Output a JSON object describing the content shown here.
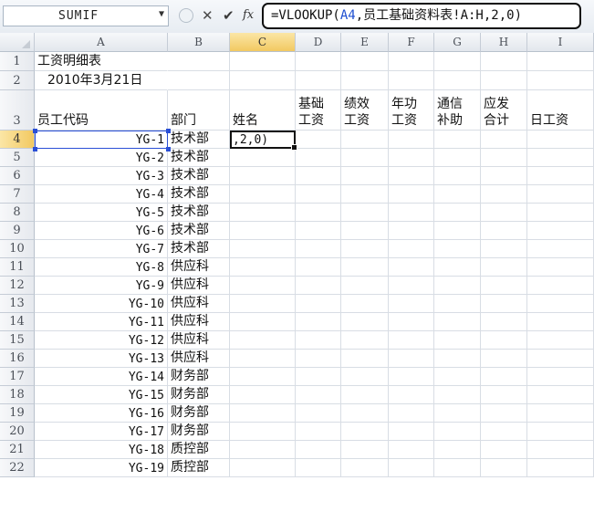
{
  "formula_bar": {
    "name_box": "SUMIF",
    "cancel_icon": "✕",
    "enter_icon": "✔",
    "fx_label": "fx",
    "formula_prefix": "=VLOOKUP(",
    "formula_ref": "A4",
    "formula_suffix": ",员工基础资料表!A:H,2,0)"
  },
  "columns": [
    "A",
    "B",
    "C",
    "D",
    "E",
    "F",
    "G",
    "H",
    "I"
  ],
  "active_column": "C",
  "active_row": "4",
  "rows": [
    "1",
    "2",
    "3",
    "4",
    "5",
    "6",
    "7",
    "8",
    "9",
    "10",
    "11",
    "12",
    "13",
    "14",
    "15",
    "16",
    "17",
    "18",
    "19",
    "20",
    "21",
    "22"
  ],
  "title": "工资明细表",
  "date": "2010年3月21日",
  "headers": {
    "A": "员工代码",
    "B": "部门",
    "C": "姓名",
    "D_line1": "基础",
    "D_line2": "工资",
    "E_line1": "绩效",
    "E_line2": "工资",
    "F_line1": "年功",
    "F_line2": "工资",
    "G_line1": "通信",
    "G_line2": "补助",
    "H_line1": "应发",
    "H_line2": "合计",
    "I": "日工资"
  },
  "editing_text": ",2,0)",
  "employees": [
    {
      "code": "YG-1",
      "dept": "技术部"
    },
    {
      "code": "YG-2",
      "dept": "技术部"
    },
    {
      "code": "YG-3",
      "dept": "技术部"
    },
    {
      "code": "YG-4",
      "dept": "技术部"
    },
    {
      "code": "YG-5",
      "dept": "技术部"
    },
    {
      "code": "YG-6",
      "dept": "技术部"
    },
    {
      "code": "YG-7",
      "dept": "技术部"
    },
    {
      "code": "YG-8",
      "dept": "供应科"
    },
    {
      "code": "YG-9",
      "dept": "供应科"
    },
    {
      "code": "YG-10",
      "dept": "供应科"
    },
    {
      "code": "YG-11",
      "dept": "供应科"
    },
    {
      "code": "YG-12",
      "dept": "供应科"
    },
    {
      "code": "YG-13",
      "dept": "供应科"
    },
    {
      "code": "YG-14",
      "dept": "财务部"
    },
    {
      "code": "YG-15",
      "dept": "财务部"
    },
    {
      "code": "YG-16",
      "dept": "财务部"
    },
    {
      "code": "YG-17",
      "dept": "财务部"
    },
    {
      "code": "YG-18",
      "dept": "质控部"
    },
    {
      "code": "YG-19",
      "dept": "质控部"
    }
  ],
  "colors": {
    "reference_blue": "#1f4fd1",
    "header_active": "#f2c961",
    "grid_line": "#d8dde4"
  }
}
